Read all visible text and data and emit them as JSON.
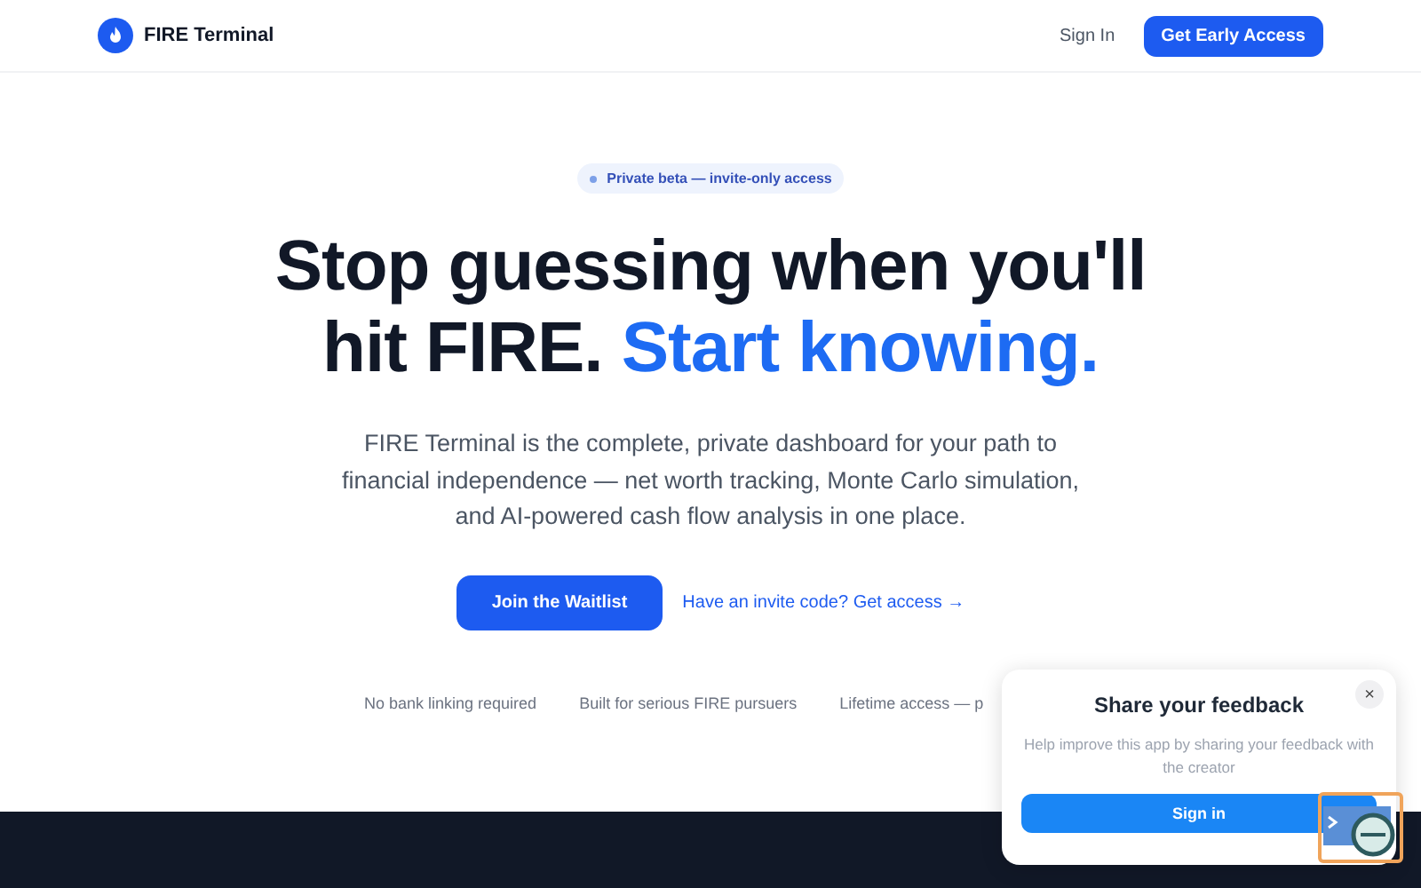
{
  "nav": {
    "brand": "FIRE Terminal",
    "links": [
      {
        "label": "Sign In",
        "kind": "link"
      },
      {
        "label": "Get Early Access",
        "kind": "primary"
      }
    ]
  },
  "hero": {
    "badge": "Private beta — invite-only access",
    "title_lines": [
      "Stop guessing when you'll",
      "hit FIRE. **Start knowing.**"
    ],
    "subtitle": "FIRE Terminal is the complete, private dashboard for your path to financial independence — net worth tracking, Monte Carlo simulation, and AI-powered cash flow analysis in one place.",
    "actions": [
      {
        "label": "Join the Waitlist",
        "kind": "primary"
      },
      {
        "label": "Have an invite code? Get access →",
        "kind": "link"
      }
    ],
    "trust": [
      "No bank linking required",
      "Built for serious FIRE pursuers",
      "Lifetime access — p"
    ]
  },
  "feedback": {
    "title": "Share your feedback",
    "close": "×",
    "text": "Help improve this app by sharing your feedback with the creator",
    "button": "Sign in"
  }
}
